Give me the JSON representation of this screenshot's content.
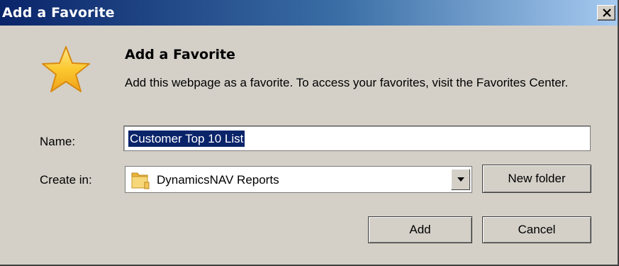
{
  "window": {
    "title": "Add a Favorite",
    "close_icon": "close-icon"
  },
  "header": {
    "icon": "star-icon",
    "heading": "Add a Favorite",
    "description": "Add this webpage as a favorite. To access your favorites, visit the Favorites Center."
  },
  "form": {
    "name_label": "Name:",
    "name_value": "Customer Top 10 List",
    "create_in_label": "Create in:",
    "create_in_value": "DynamicsNAV Reports",
    "folder_icon": "folder-icon",
    "dropdown_icon": "chevron-down-icon"
  },
  "buttons": {
    "new_folder": "New folder",
    "add": "Add",
    "cancel": "Cancel"
  },
  "colors": {
    "dialog_bg": "#d4d0c8",
    "titlebar_start": "#0a246a",
    "titlebar_end": "#a6caf0",
    "selection": "#0a246a",
    "star": "#f7c02c"
  }
}
